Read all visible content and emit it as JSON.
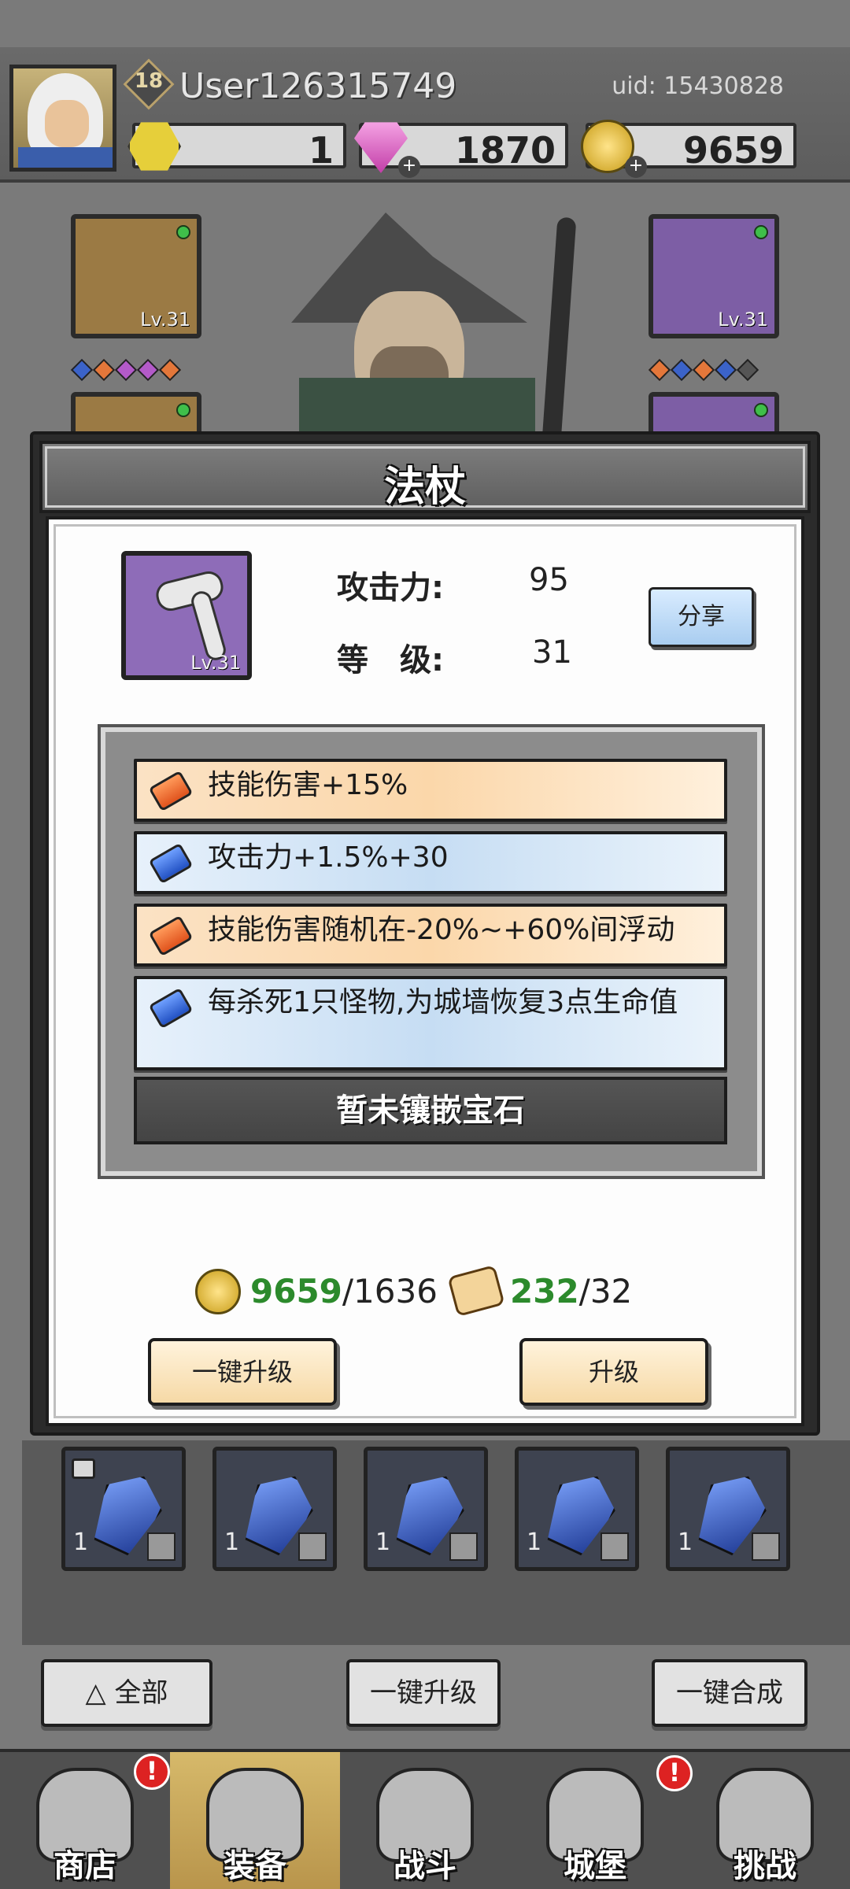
{
  "player": {
    "level": "18",
    "name": "User126315749",
    "uid": "uid: 15430828"
  },
  "resources": [
    {
      "name": "hex-token",
      "value": "1"
    },
    {
      "name": "gem",
      "value": "1870"
    },
    {
      "name": "gold",
      "value": "9659"
    }
  ],
  "hero_slots": {
    "left_top_lv": "Lv.31",
    "right_top_lv": "Lv.31"
  },
  "modal": {
    "title": "法杖",
    "item_lv": "Lv.31",
    "attack_label": "攻击力:",
    "attack_value": "95",
    "level_label": "等　级:",
    "level_value": "31",
    "share_label": "分享",
    "attributes": [
      {
        "text": "技能伤害+15%",
        "color": "orange"
      },
      {
        "text": "攻击力+1.5%+30",
        "color": "blue"
      },
      {
        "text": "技能伤害随机在-20%~+60%间浮动",
        "color": "orange"
      },
      {
        "text": "每杀死1只怪物,为城墙恢复3点生命值",
        "color": "blue"
      }
    ],
    "empty_gem": "暂未镶嵌宝石",
    "cost_gold_have": "9659",
    "cost_gold_need": "/1636",
    "cost_scroll_have": "232",
    "cost_scroll_need": "/32",
    "quick_upgrade": "一键升级",
    "upgrade": "升级"
  },
  "inventory": [
    {
      "count": "1",
      "locked": true
    },
    {
      "count": "1"
    },
    {
      "count": "1"
    },
    {
      "count": "1"
    },
    {
      "count": "1"
    }
  ],
  "actions": {
    "all": "全部",
    "quick_upgrade": "一键升级",
    "quick_merge": "一键合成"
  },
  "nav": [
    {
      "label": "商店",
      "alert": "!"
    },
    {
      "label": "装备",
      "alert": "!"
    },
    {
      "label": "战斗"
    },
    {
      "label": "城堡",
      "alert": "!"
    },
    {
      "label": "挑战"
    }
  ],
  "colors": {
    "accent_green": "#2c8a2c",
    "alert_red": "#dd2222",
    "active_tab": "#c8a55a"
  }
}
